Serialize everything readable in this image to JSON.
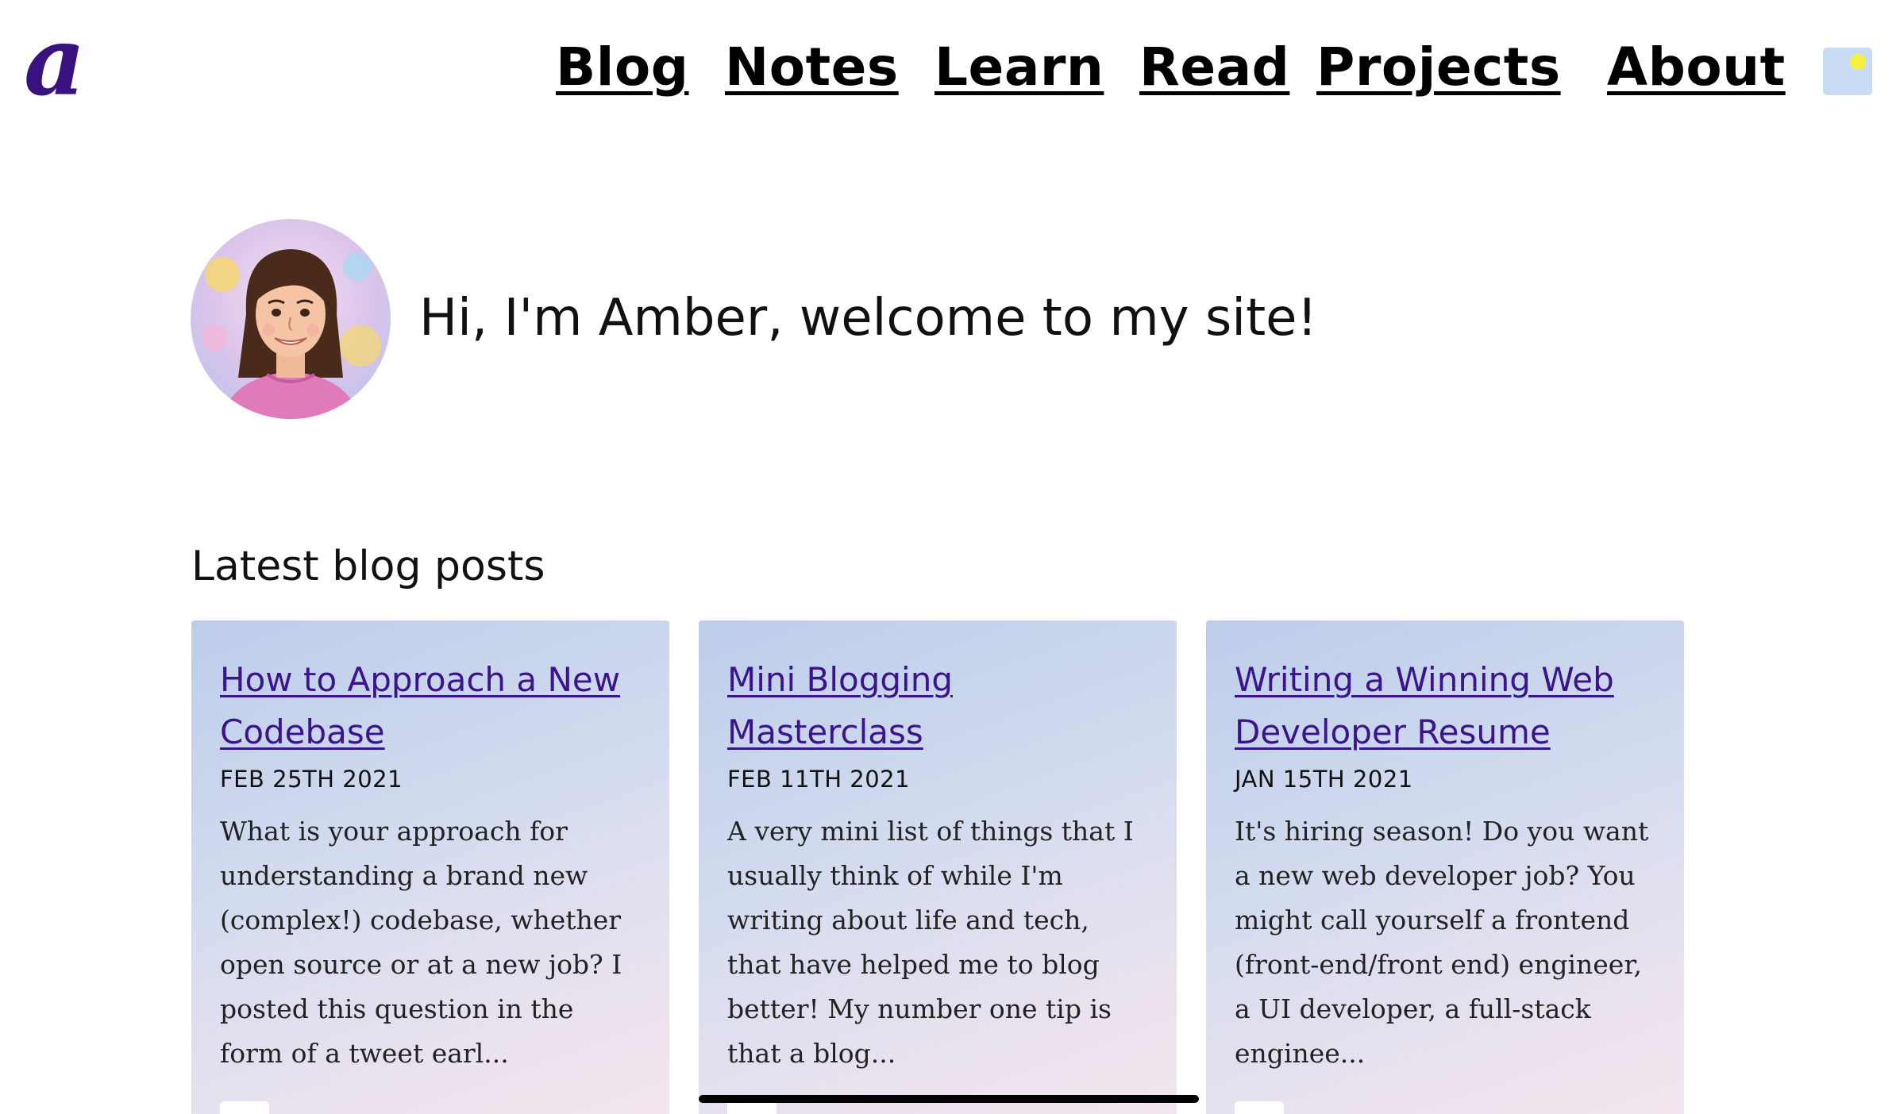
{
  "header": {
    "logo_text": "a",
    "nav": [
      {
        "label": "Blog"
      },
      {
        "label": "Notes"
      },
      {
        "label": "Learn"
      },
      {
        "label": "Read"
      },
      {
        "label": "Projects"
      },
      {
        "label": "About"
      }
    ],
    "theme_toggle_icon": "sun-icon"
  },
  "intro": {
    "greeting": "Hi, I'm Amber, welcome to my site!",
    "avatar_icon": "avatar-portrait"
  },
  "latest_posts": {
    "heading": "Latest blog posts",
    "posts": [
      {
        "title": "How to Approach a New Codebase",
        "date": "FEB 25TH 2021",
        "excerpt": "What is your approach for understanding a brand new (complex!) codebase, whether open source or at a new job? I posted this question in the form of a tweet earl..."
      },
      {
        "title": "Mini Blogging Masterclass",
        "date": "FEB 11TH 2021",
        "excerpt": "A very mini list of things that I usually think of while I'm writing about life and tech, that have helped me to blog better! My number one tip is that a blog..."
      },
      {
        "title": "Writing a Winning Web Developer Resume",
        "date": "JAN 15TH 2021",
        "excerpt": "It's hiring season! Do you want a new web developer job? You might call yourself a frontend (front-end/front end) engineer, a UI developer, a full-stack enginee..."
      }
    ]
  },
  "colors": {
    "accent": "#3b148c",
    "logo": "#3a1280",
    "toggle_bg": "#c9dcf6",
    "sun": "#f6f040",
    "card_gradient_start": "#bccdea",
    "card_gradient_end": "#f3e6ef"
  }
}
